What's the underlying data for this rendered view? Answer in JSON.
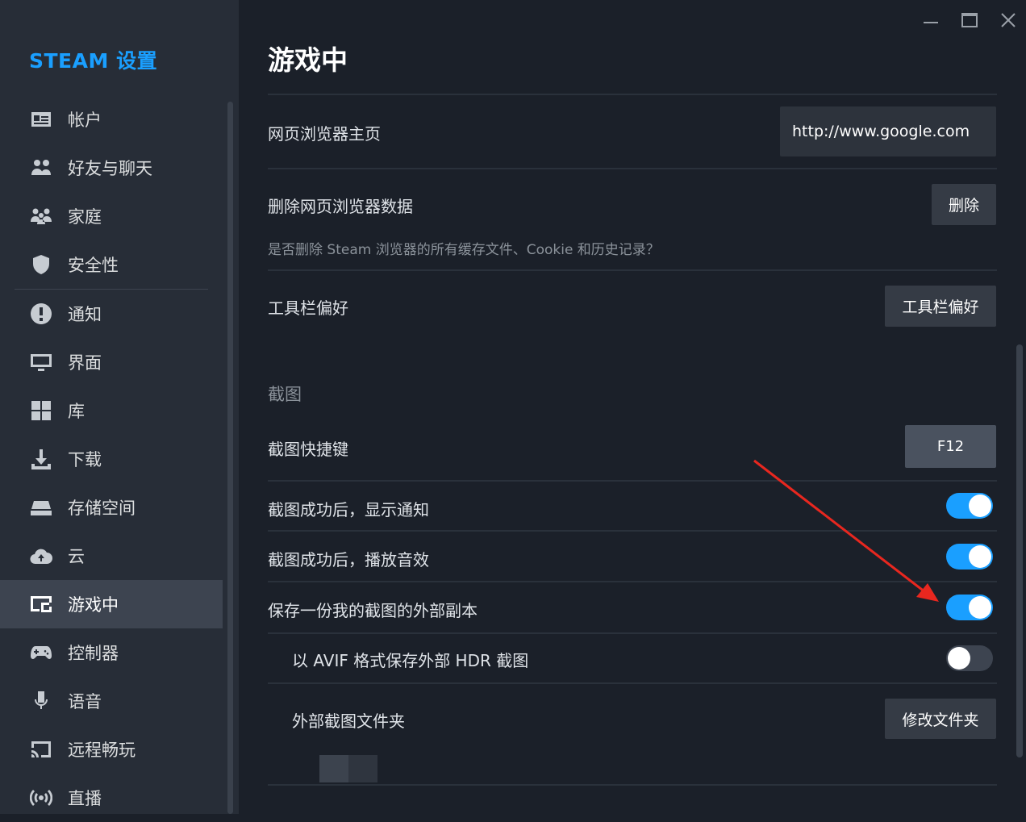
{
  "sidebar": {
    "brand": "STEAM 设置",
    "items": [
      {
        "label": "帐户",
        "icon": "account-card-icon"
      },
      {
        "label": "好友与聊天",
        "icon": "friends-icon"
      },
      {
        "label": "家庭",
        "icon": "family-icon"
      },
      {
        "label": "安全性",
        "icon": "shield-icon"
      },
      {
        "label": "通知",
        "icon": "alert-icon"
      },
      {
        "label": "界面",
        "icon": "monitor-icon"
      },
      {
        "label": "库",
        "icon": "grid-icon"
      },
      {
        "label": "下载",
        "icon": "download-icon"
      },
      {
        "label": "存储空间",
        "icon": "drive-icon"
      },
      {
        "label": "云",
        "icon": "cloud-icon"
      },
      {
        "label": "游戏中",
        "icon": "in-game-icon",
        "active": true
      },
      {
        "label": "控制器",
        "icon": "controller-icon"
      },
      {
        "label": "语音",
        "icon": "microphone-icon"
      },
      {
        "label": "远程畅玩",
        "icon": "cast-icon"
      },
      {
        "label": "直播",
        "icon": "broadcast-icon"
      }
    ]
  },
  "main": {
    "title": "游戏中",
    "browser_home": {
      "label": "网页浏览器主页",
      "value": "http://www.google.com"
    },
    "delete_browser": {
      "label": "删除网页浏览器数据",
      "button": "删除",
      "desc": "是否删除 Steam 浏览器的所有缓存文件、Cookie 和历史记录？"
    },
    "toolbar": {
      "label": "工具栏偏好",
      "button": "工具栏偏好"
    },
    "screenshots": {
      "section": "截图",
      "hotkey": {
        "label": "截图快捷键",
        "value": "F12"
      },
      "notify": {
        "label": "截图成功后，显示通知",
        "on": true
      },
      "sound": {
        "label": "截图成功后，播放音效",
        "on": true
      },
      "external_copy": {
        "label": "保存一份我的截图的外部副本",
        "on": true
      },
      "avif": {
        "label": "以 AVIF 格式保存外部 HDR 截图",
        "on": false
      },
      "folder": {
        "label": "外部截图文件夹",
        "button": "修改文件夹"
      }
    }
  },
  "colors": {
    "accent": "#1a9fff",
    "annotation_arrow": "#e8271f"
  }
}
